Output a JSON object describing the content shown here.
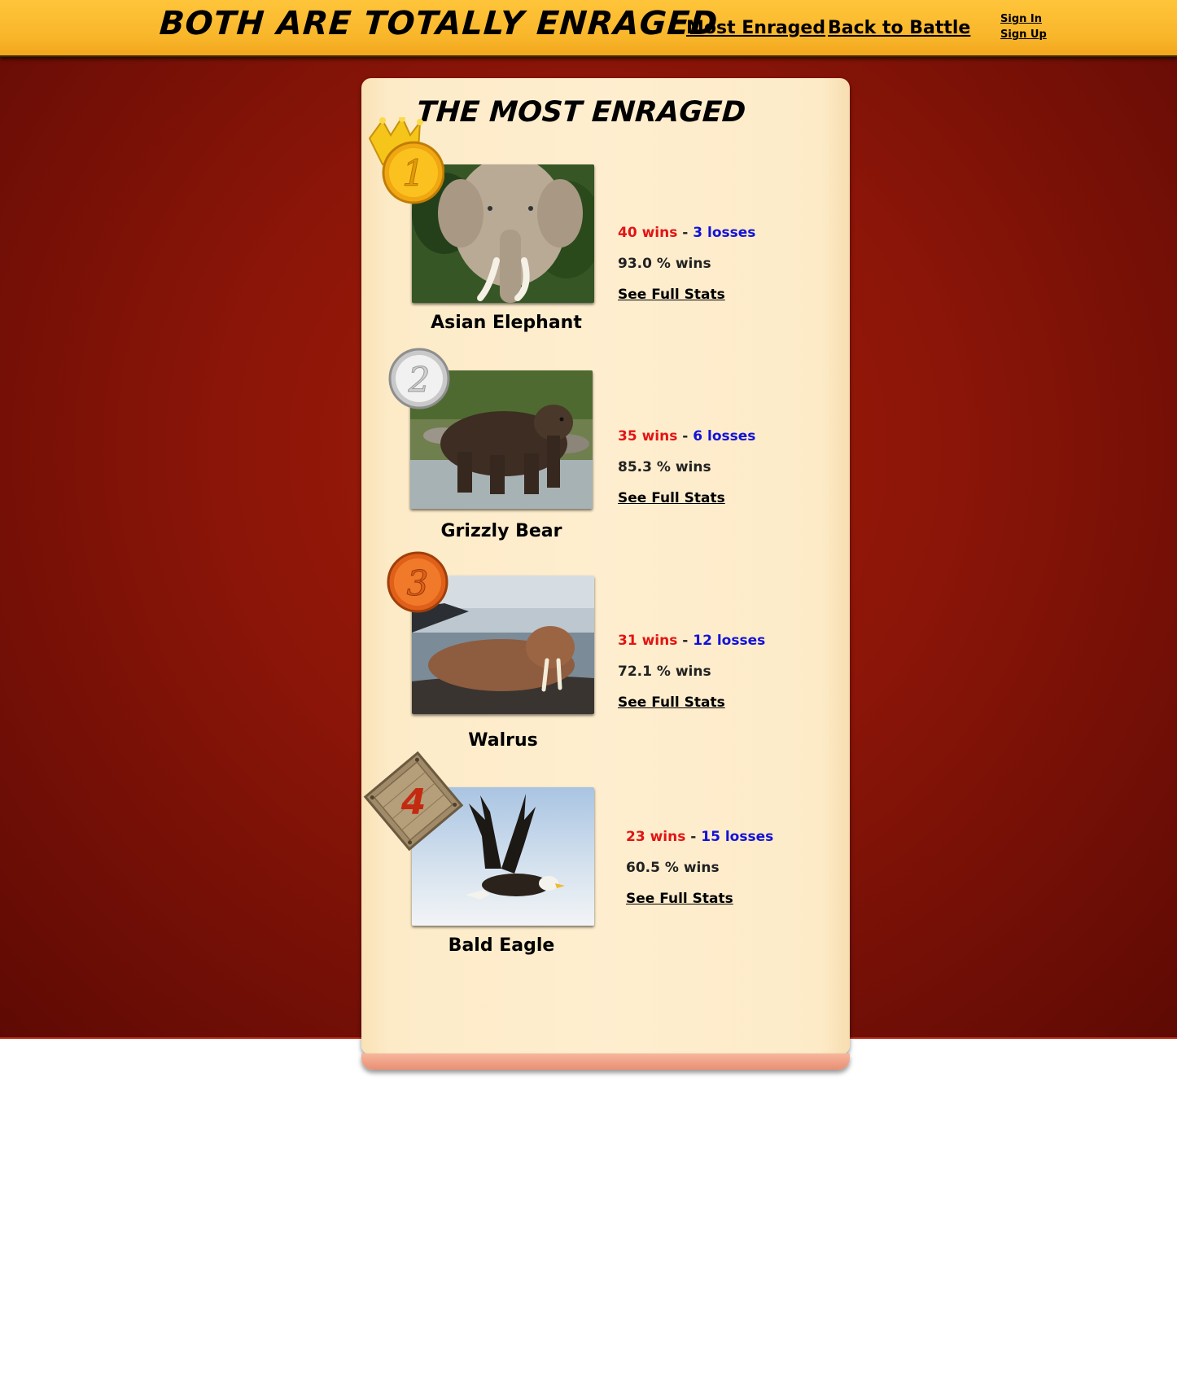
{
  "header": {
    "title": "BOTH ARE TOTALLY ENRAGED",
    "nav": {
      "most_enraged": "Most Enraged",
      "back_to_battle": "Back to Battle"
    },
    "account": {
      "sign_in": "Sign In",
      "sign_up": "Sign Up"
    }
  },
  "page": {
    "title": "THE MOST ENRAGED"
  },
  "ranking": [
    {
      "rank": "1",
      "name": "Asian Elephant",
      "wins": "40 wins",
      "sep": "-",
      "losses": "3 losses",
      "pct": "93.0 % wins",
      "link": "See Full Stats",
      "badge": "gold-crown-medal-icon"
    },
    {
      "rank": "2",
      "name": "Grizzly Bear",
      "wins": "35 wins",
      "sep": "-",
      "losses": "6 losses",
      "pct": "85.3 % wins",
      "link": "See Full Stats",
      "badge": "silver-medal-icon"
    },
    {
      "rank": "3",
      "name": "Walrus",
      "wins": "31 wins",
      "sep": "-",
      "losses": "12 losses",
      "pct": "72.1 % wins",
      "link": "See Full Stats",
      "badge": "bronze-medal-icon"
    },
    {
      "rank": "4",
      "name": "Bald Eagle",
      "wins": "23 wins",
      "sep": "-",
      "losses": "15 losses",
      "pct": "60.5 % wins",
      "link": "See Full Stats",
      "badge": "wooden-plaque-icon"
    }
  ],
  "colors": {
    "header": "#f8b52a",
    "background": "#8a1508",
    "panel": "#feeecf",
    "wins": "#e31414",
    "losses": "#1212d8"
  }
}
